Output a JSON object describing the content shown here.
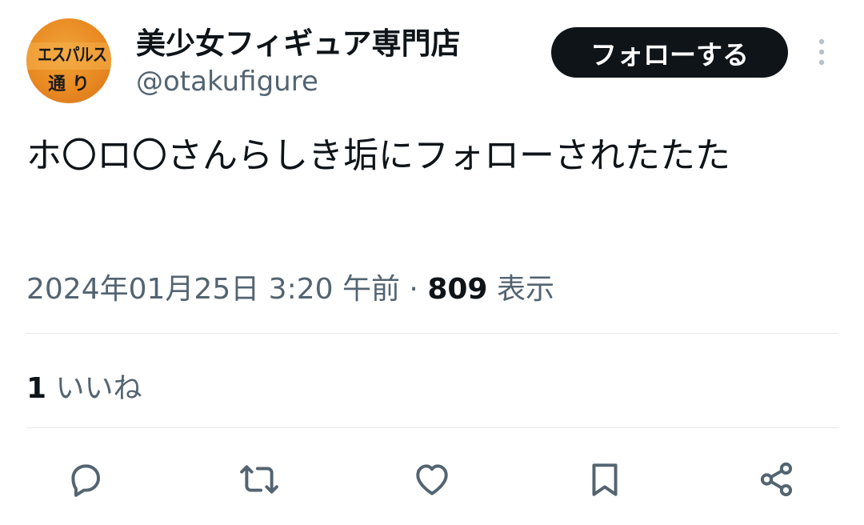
{
  "author": {
    "avatar_text_line1": "エスパルス",
    "avatar_text_line2": "通 り",
    "display_name": "美少女フィギュア専門店",
    "handle": "@otakufigure"
  },
  "follow_button_label": "フォローする",
  "tweet": {
    "text": "ホ〇ロ〇さんらしき垢にフォローされたたた",
    "timestamp": "2024年01月25日 3:20 午前",
    "separator": "·",
    "views_count": "809",
    "views_label": "表示"
  },
  "engagement": {
    "likes_count": "1",
    "likes_label": "いいね"
  },
  "actions": [
    "reply-icon",
    "retweet-icon",
    "like-icon",
    "bookmark-icon",
    "share-icon"
  ],
  "colors": {
    "text": "#0f1419",
    "secondary": "#536471",
    "icon": "#536471",
    "follow_bg": "#0f1419",
    "avatar_orange": "#e98a22"
  }
}
